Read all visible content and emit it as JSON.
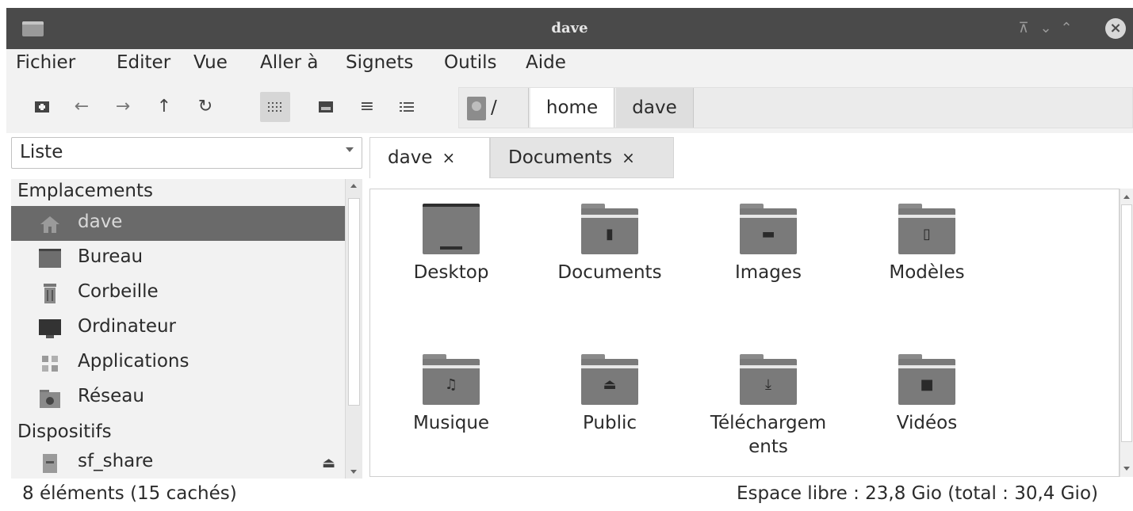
{
  "window": {
    "title": "dave"
  },
  "menu": [
    {
      "label": "Fichier"
    },
    {
      "label": "Editer"
    },
    {
      "label": "Vue"
    },
    {
      "label": "Aller à"
    },
    {
      "label": "Signets"
    },
    {
      "label": "Outils"
    },
    {
      "label": "Aide"
    }
  ],
  "toolbar": {
    "path_root": "/",
    "path_segments": [
      "home",
      "dave"
    ],
    "active_view": "icon-view"
  },
  "sidebar": {
    "mode": "Liste",
    "places_header": "Emplacements",
    "places": [
      {
        "label": "dave",
        "icon": "home-icon",
        "selected": true
      },
      {
        "label": "Bureau",
        "icon": "desktop-icon"
      },
      {
        "label": "Corbeille",
        "icon": "trash-icon"
      },
      {
        "label": "Ordinateur",
        "icon": "computer-icon"
      },
      {
        "label": "Applications",
        "icon": "applications-icon"
      },
      {
        "label": "Réseau",
        "icon": "network-icon"
      }
    ],
    "devices_header": "Dispositifs",
    "devices": [
      {
        "label": "sf_share",
        "icon": "drive-icon"
      }
    ]
  },
  "tabs": [
    {
      "label": "dave",
      "close": "×",
      "active": true
    },
    {
      "label": "Documents",
      "close": "×",
      "active": false
    }
  ],
  "files": [
    {
      "name": "Desktop",
      "icon": "desktop-folder-icon"
    },
    {
      "name": "Documents",
      "icon": "documents-folder-icon"
    },
    {
      "name": "Images",
      "icon": "images-folder-icon"
    },
    {
      "name": "Modèles",
      "icon": "templates-folder-icon"
    },
    {
      "name": "Musique",
      "icon": "music-folder-icon"
    },
    {
      "name": "Public",
      "icon": "public-folder-icon"
    },
    {
      "name_line1": "Téléchargem",
      "name_line2": "ents",
      "icon": "downloads-folder-icon"
    },
    {
      "name": "Vidéos",
      "icon": "videos-folder-icon"
    }
  ],
  "status": {
    "items": "8 éléments (15 cachés)",
    "space": "Espace libre : 23,8 Gio (total : 30,4 Gio)"
  },
  "colors": {
    "titlebar": "#4a4a4a",
    "selection": "#6a6a6a",
    "folder": "#7a7a7a"
  }
}
